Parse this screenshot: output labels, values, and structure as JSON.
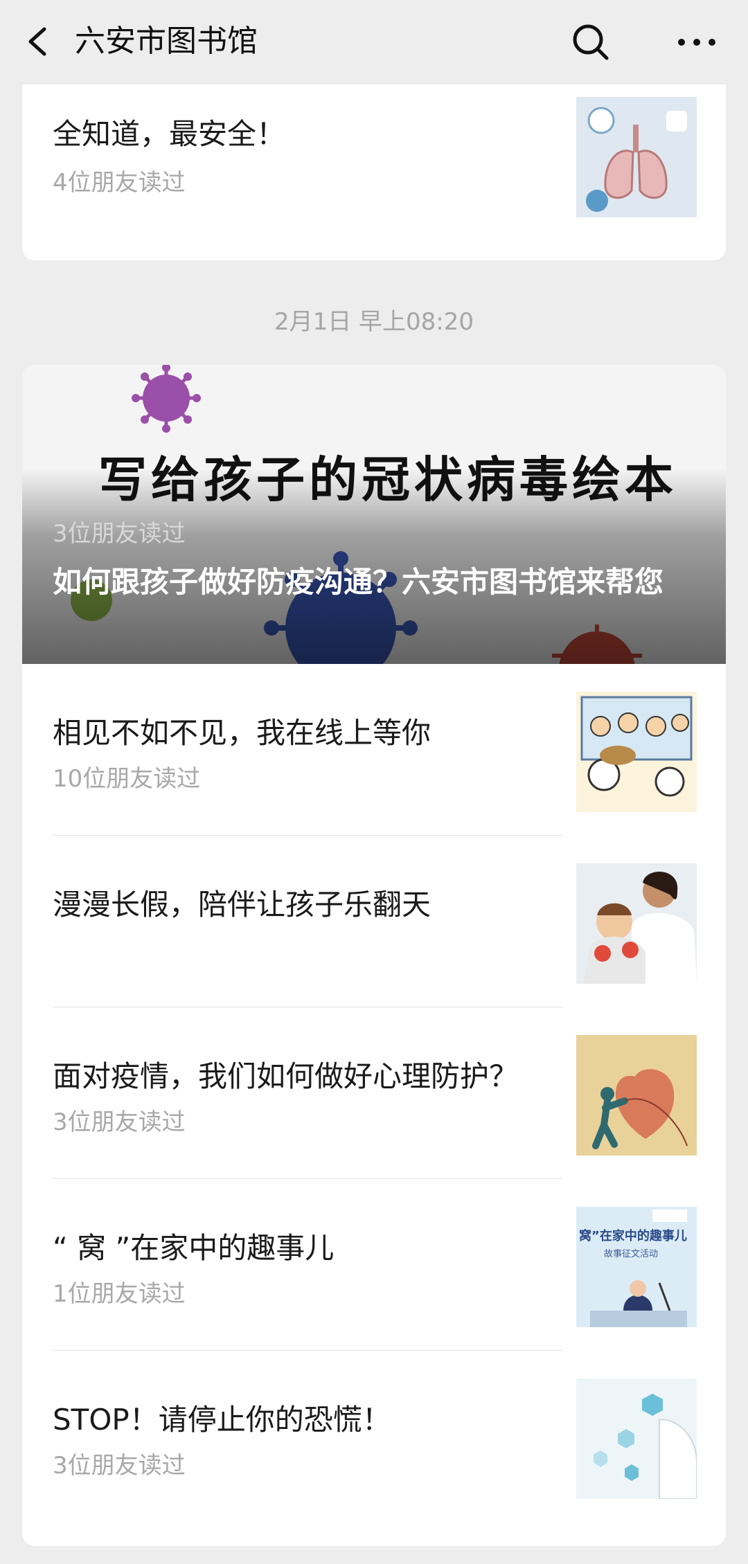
{
  "header": {
    "title": "六安市图书馆"
  },
  "top_article": {
    "title": "全知道，最安全！",
    "reads": "4位朋友读过",
    "thumb_icon": "lungs-illustration"
  },
  "timestamp": "2月1日 早上08:20",
  "hero": {
    "caption": "写给孩子的冠状病毒绘本",
    "reads": "3位朋友读过",
    "title": "如何跟孩子做好防疫沟通？六安市图书馆来帮您"
  },
  "articles": [
    {
      "title": "相见不如不见，我在线上等你",
      "reads": "10位朋友读过",
      "thumb_icon": "cartoon-crowd-illustration"
    },
    {
      "title": "漫漫长假，陪伴让孩子乐翻天",
      "reads": "",
      "thumb_icon": "mother-child-photo"
    },
    {
      "title": "面对疫情，我们如何做好心理防护？",
      "reads": "3位朋友读过",
      "thumb_icon": "heart-figure-illustration"
    },
    {
      "title": "“ 窝 ”在家中的趣事儿",
      "reads": "1位朋友读过",
      "thumb_icon": "story-poster"
    },
    {
      "title": "STOP！请停止你的恐慌！",
      "reads": "3位朋友读过",
      "thumb_icon": "medical-hexagon-illustration"
    }
  ],
  "poster_text": {
    "line1": "窝”在家中的趣事儿",
    "line2": "故事征文活动"
  }
}
